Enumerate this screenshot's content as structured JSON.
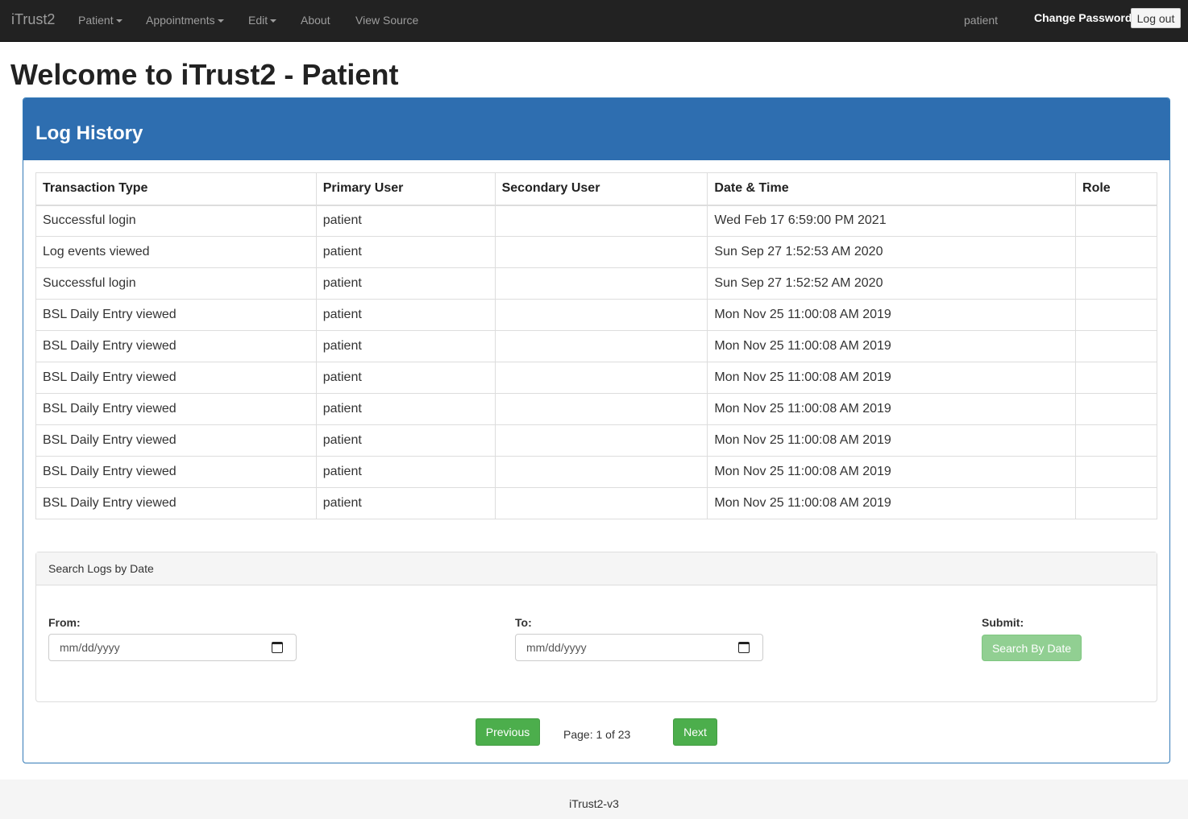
{
  "navbar": {
    "brand": "iTrust2",
    "menu": [
      {
        "label": "Patient",
        "dropdown": true
      },
      {
        "label": "Appointments",
        "dropdown": true
      },
      {
        "label": "Edit",
        "dropdown": true
      },
      {
        "label": "About",
        "dropdown": false
      },
      {
        "label": "View Source",
        "dropdown": false
      }
    ],
    "username": "patient",
    "change_password": "Change Password",
    "logout": "Log out"
  },
  "page_title": "Welcome to iTrust2 - Patient",
  "panel": {
    "title": "Log History",
    "table": {
      "columns": [
        "Transaction Type",
        "Primary User",
        "Secondary User",
        "Date & Time",
        "Role"
      ],
      "rows": [
        [
          "Successful login",
          "patient",
          "",
          "Wed Feb 17 6:59:00 PM 2021",
          ""
        ],
        [
          "Log events viewed",
          "patient",
          "",
          "Sun Sep 27 1:52:53 AM 2020",
          ""
        ],
        [
          "Successful login",
          "patient",
          "",
          "Sun Sep 27 1:52:52 AM 2020",
          ""
        ],
        [
          "BSL Daily Entry viewed",
          "patient",
          "",
          "Mon Nov 25 11:00:08 AM 2019",
          ""
        ],
        [
          "BSL Daily Entry viewed",
          "patient",
          "",
          "Mon Nov 25 11:00:08 AM 2019",
          ""
        ],
        [
          "BSL Daily Entry viewed",
          "patient",
          "",
          "Mon Nov 25 11:00:08 AM 2019",
          ""
        ],
        [
          "BSL Daily Entry viewed",
          "patient",
          "",
          "Mon Nov 25 11:00:08 AM 2019",
          ""
        ],
        [
          "BSL Daily Entry viewed",
          "patient",
          "",
          "Mon Nov 25 11:00:08 AM 2019",
          ""
        ],
        [
          "BSL Daily Entry viewed",
          "patient",
          "",
          "Mon Nov 25 11:00:08 AM 2019",
          ""
        ],
        [
          "BSL Daily Entry viewed",
          "patient",
          "",
          "Mon Nov 25 11:00:08 AM 2019",
          ""
        ]
      ]
    },
    "search": {
      "heading": "Search Logs by Date",
      "from_label": "From:",
      "from_placeholder": "mm/dd/yyyy",
      "to_label": "To:",
      "to_placeholder": "mm/dd/yyyy",
      "submit_label": "Submit:",
      "submit_button": "Search By Date"
    },
    "pagination": {
      "previous": "Previous",
      "page_text": "Page: 1 of 23",
      "next": "Next"
    }
  },
  "footer": "iTrust2-v3",
  "colors": {
    "navbar_bg": "#222222",
    "panel_primary": "#2e6eb0",
    "success_button": "#4cae4c",
    "disabled_success_button": "#91cf92"
  }
}
